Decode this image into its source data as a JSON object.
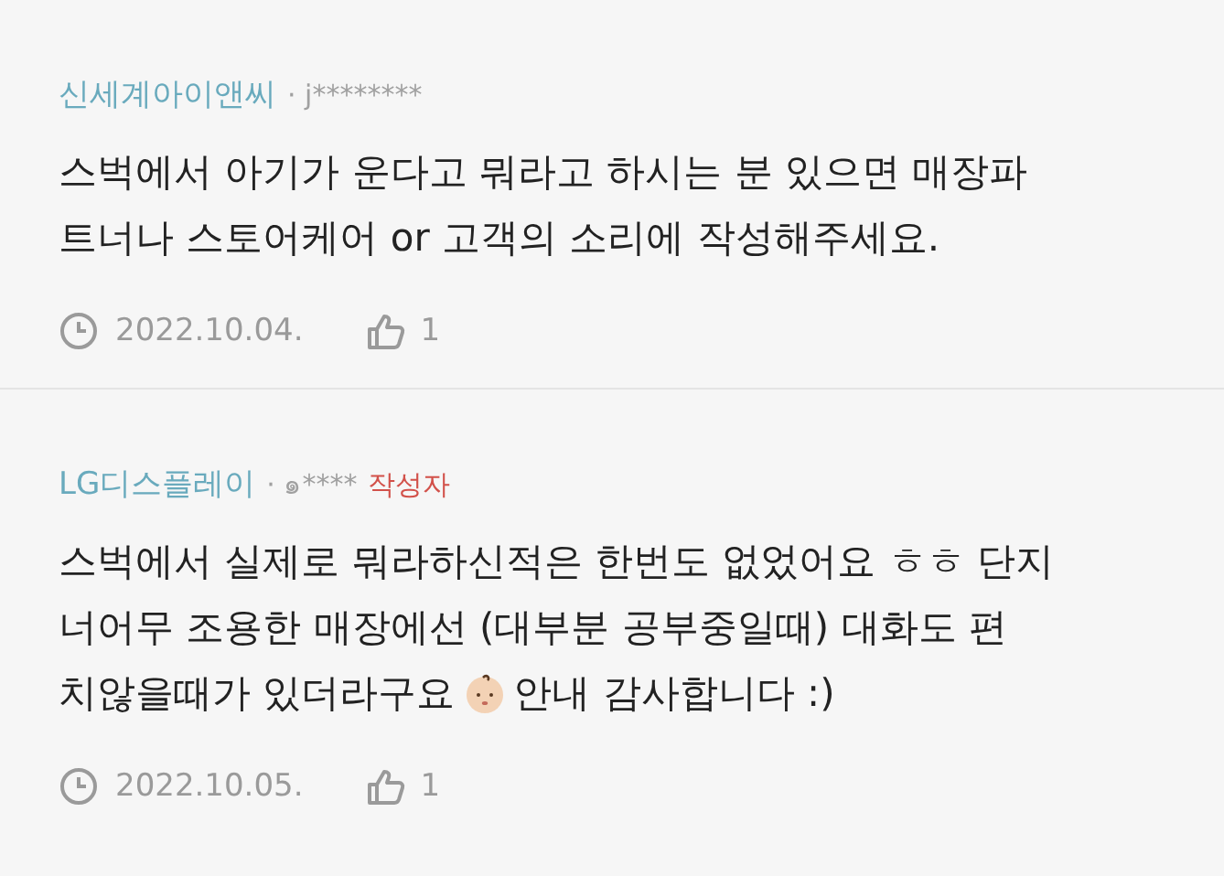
{
  "comments": [
    {
      "author": "신세계아이앤씨",
      "user": "· j********",
      "lines": [
        "스벅에서 아기가 운다고 뭐라고 하시는 분 있으면 매장파",
        "트너나 스토어케어 or 고객의 소리에 작성해주세요."
      ],
      "date": "2022.10.04.",
      "likes": "1"
    },
    {
      "author": "LG디스플레이",
      "user": "· ๑****",
      "writer_badge": "작성자",
      "lines": [
        "스벅에서 실제로 뭐라하신적은 한번도 없었어요 ㅎㅎ 단지",
        "너어무 조용한 매장에선 (대부분 공부중일때) 대화도 편"
      ],
      "emoji_line": {
        "before": "치않을때가 있더라구요",
        "after": "안내 감사합니다 :)"
      },
      "date": "2022.10.05.",
      "likes": "1"
    }
  ]
}
